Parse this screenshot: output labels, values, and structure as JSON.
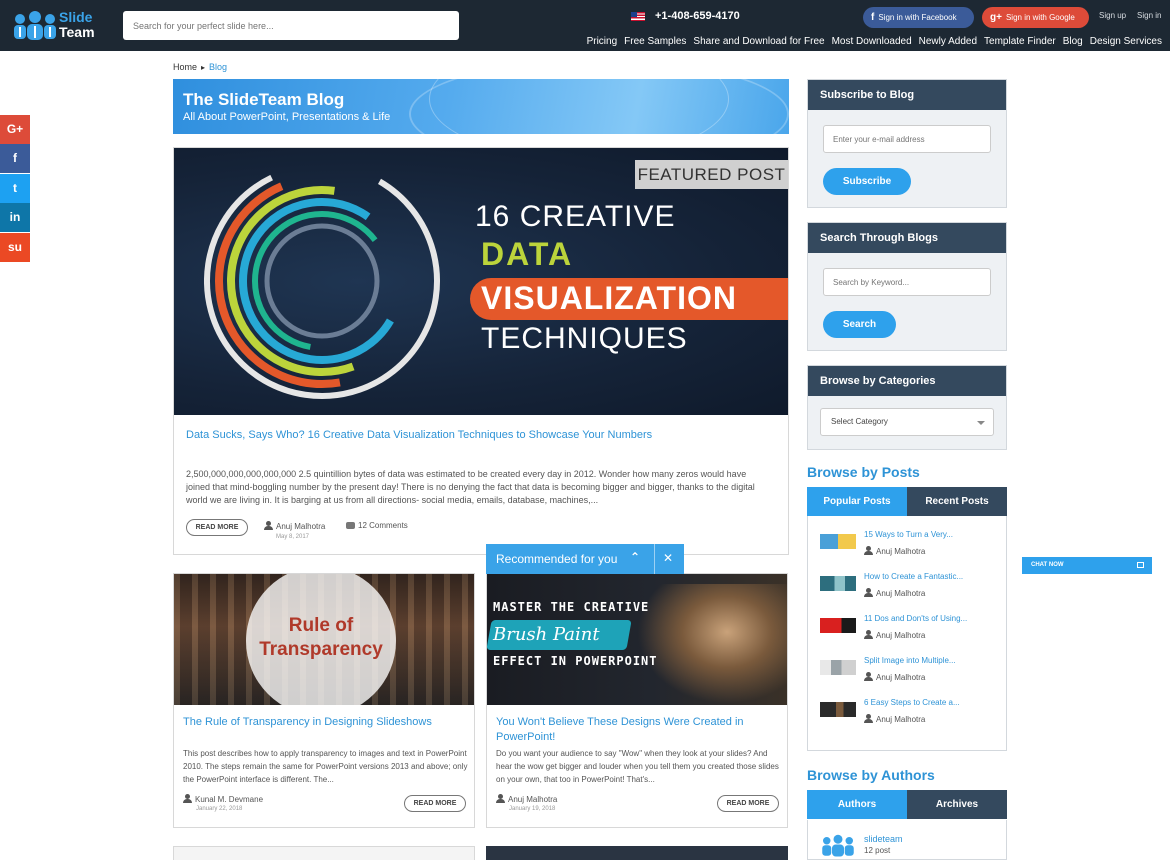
{
  "header": {
    "logo_line1": "Slide",
    "logo_line2": "Team",
    "search_placeholder": "Search for your perfect slide here...",
    "phone": "+1-408-659-4170",
    "facebook_btn": "Sign in with Facebook",
    "google_btn": "Sign in with Google",
    "signup": "Sign up",
    "signin": "Sign in",
    "nav": [
      "Pricing",
      "Free Samples",
      "Share and Download for Free",
      "Most Downloaded",
      "Newly Added",
      "Template Finder",
      "Blog",
      "Design Services"
    ]
  },
  "social": [
    {
      "glyph": "G+",
      "color": "#dd4b39"
    },
    {
      "glyph": "f",
      "color": "#3b5b99"
    },
    {
      "glyph": "t",
      "color": "#1da1f2"
    },
    {
      "glyph": "in",
      "color": "#0e76a8"
    },
    {
      "glyph": "su",
      "color": "#eb4924"
    }
  ],
  "breadcrumb": {
    "home": "Home",
    "current": "Blog"
  },
  "banner": {
    "title": "The SlideTeam Blog",
    "subtitle": "All About PowerPoint, Presentations & Life"
  },
  "featured": {
    "tag": "FEATURED POST",
    "img_line1": "16 CREATIVE",
    "img_line2": "DATA",
    "img_line3": "VISUALIZATION",
    "img_line4": "TECHNIQUES",
    "title": "Data Sucks, Says Who? 16 Creative Data Visualization Techniques to Showcase Your Numbers",
    "excerpt": "2,500,000,000,000,000,000 2.5 quintillion bytes of data was estimated to be created every day in 2012. Wonder how many zeros would have joined that mind-boggling number by the present day! There is no denying the fact that data is becoming bigger and bigger, thanks to the digital world we are living in. It is barging at us from all directions- social media, emails, database, machines,...",
    "read_more": "READ MORE",
    "author": "Anuj Malhotra",
    "date": "May 8, 2017",
    "comments": "12 Comments"
  },
  "posts": [
    {
      "img_text": "Rule of Transparency",
      "title": "The Rule of Transparency in Designing Slideshows",
      "excerpt": "This post describes how to apply transparency to images and text in PowerPoint 2010. The steps remain the same for PowerPoint versions 2013 and above; only the PowerPoint interface is different.  The...",
      "author": "Kunal M. Devmane",
      "date": "January 22, 2018",
      "read_more": "READ MORE"
    },
    {
      "img_line1": "MASTER THE CREATIVE",
      "img_line2": "Brush Paint",
      "img_line3": "EFFECT IN POWERPOINT",
      "title": "You Won't Believe These Designs Were Created in PowerPoint!",
      "excerpt": "Do you want your audience to say \"Wow\" when they look at your slides? And hear the wow get bigger and louder when you tell them you created those slides on your own, that too in PowerPoint!  That's...",
      "author": "Anuj Malhotra",
      "date": "January 19, 2018",
      "read_more": "READ MORE"
    }
  ],
  "recommended": {
    "label": "Recommended for you"
  },
  "sidebar": {
    "subscribe": {
      "title": "Subscribe to Blog",
      "placeholder": "Enter your e-mail address",
      "button": "Subscribe"
    },
    "search": {
      "title": "Search Through Blogs",
      "placeholder": "Search by Keyword...",
      "button": "Search"
    },
    "categories": {
      "title": "Browse by Categories",
      "selected": "Select Category"
    },
    "posts": {
      "title": "Browse by Posts",
      "tab_popular": "Popular Posts",
      "tab_recent": "Recent Posts",
      "items": [
        {
          "title": "15 Ways to Turn a Very...",
          "author": "Anuj Malhotra",
          "thumb": "#4aa0d8"
        },
        {
          "title": "How to Create a Fantastic...",
          "author": "Anuj Malhotra",
          "thumb": "#2d6e7e"
        },
        {
          "title": "11 Dos and Don'ts of Using...",
          "author": "Anuj Malhotra",
          "thumb": "#d9201f"
        },
        {
          "title": "Split Image into Multiple...",
          "author": "Anuj Malhotra",
          "thumb": "#9aa3a8"
        },
        {
          "title": "6 Easy Steps to Create a...",
          "author": "Anuj Malhotra",
          "thumb": "#2a2a2a"
        }
      ]
    },
    "authors": {
      "title": "Browse by Authors",
      "tab_authors": "Authors",
      "tab_archives": "Archives",
      "items": [
        {
          "name": "slideteam",
          "count": "12 post"
        }
      ]
    }
  },
  "chat": {
    "label": "CHAT NOW"
  },
  "colors": {
    "header_bg": "#1d2833",
    "accent": "#2ea1ec",
    "link": "#2e93d6",
    "sidebar_head": "#34495e"
  }
}
